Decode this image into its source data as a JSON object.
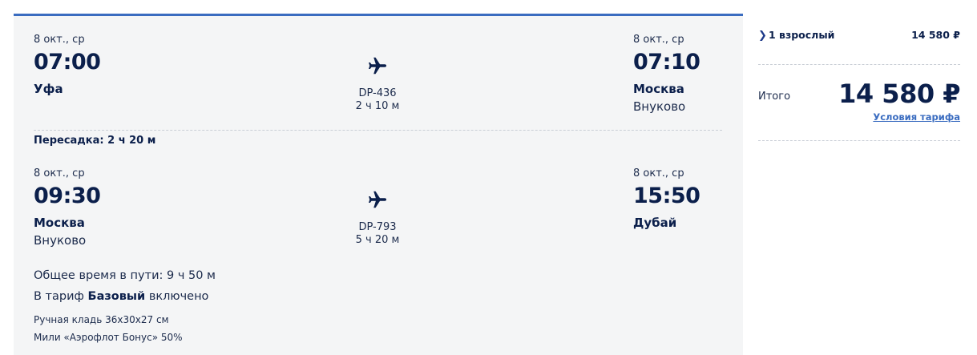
{
  "segments": [
    {
      "dep_date": "8 окт., ср",
      "dep_time": "07:00",
      "dep_city": "Уфа",
      "dep_airport": "",
      "flight_number": "DP-436",
      "duration": "2 ч 10 м",
      "arr_date": "8 окт., ср",
      "arr_time": "07:10",
      "arr_city": "Москва",
      "arr_airport": "Внуково"
    },
    {
      "dep_date": "8 окт., ср",
      "dep_time": "09:30",
      "dep_city": "Москва",
      "dep_airport": "Внуково",
      "flight_number": "DP-793",
      "duration": "5 ч 20 м",
      "arr_date": "8 окт., ср",
      "arr_time": "15:50",
      "arr_city": "Дубай",
      "arr_airport": ""
    }
  ],
  "transfer": "Пересадка: 2 ч 20 м",
  "total_travel_time": "Общее время в пути: 9 ч 50 м",
  "tariff": {
    "prefix": "В тариф",
    "name": "Базовый",
    "suffix": "включено"
  },
  "extras": [
    "Ручная кладь 36x30x27 см",
    "Мили «Аэрофлот Бонус» 50%"
  ],
  "summary": {
    "passengers_label": "1 взрослый",
    "passengers_price": "14 580 ₽",
    "total_label": "Итого",
    "total_price": "14 580 ₽",
    "fare_conditions_link": "Условия тарифа"
  },
  "icons": {
    "plane": "airplane-icon",
    "chevron": "chevron-right-icon"
  },
  "colors": {
    "text_dark": "#0b1f4b",
    "accent_blue": "#3a6cc0",
    "card_bg": "#f4f5f6"
  }
}
